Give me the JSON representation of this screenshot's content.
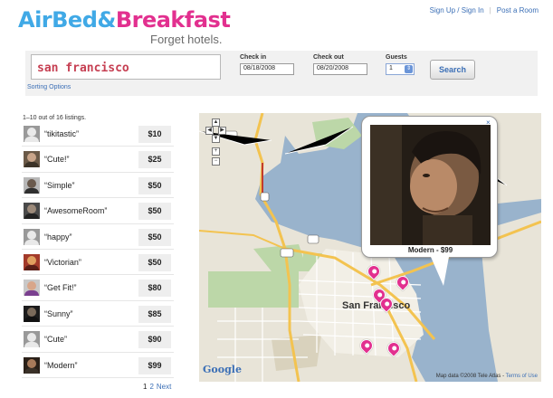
{
  "brand": {
    "part1": "AirBed",
    "amp": "&",
    "part2": "Breakfast",
    "tagline": "Forget hotels."
  },
  "header": {
    "signup": "Sign Up / Sign In",
    "sep": "|",
    "post": "Post a Room"
  },
  "search": {
    "where_value": "san francisco",
    "sorting": "Sorting Options",
    "checkin_label": "Check in",
    "checkin_value": "08/18/2008",
    "checkout_label": "Check out",
    "checkout_value": "08/20/2008",
    "guests_label": "Guests",
    "guests_value": "1",
    "button": "Search"
  },
  "results": {
    "count": "1–10 out of 16 listings.",
    "items": [
      {
        "name": "“tikitastic”",
        "price": "$10"
      },
      {
        "name": "“Cute!”",
        "price": "$25"
      },
      {
        "name": "“Simple”",
        "price": "$50"
      },
      {
        "name": "“AwesomeRoom”",
        "price": "$50"
      },
      {
        "name": "“happy”",
        "price": "$50"
      },
      {
        "name": "“Victorian”",
        "price": "$50"
      },
      {
        "name": "“Get Fit!”",
        "price": "$80"
      },
      {
        "name": "“Sunny”",
        "price": "$85"
      },
      {
        "name": "“Cute”",
        "price": "$90"
      },
      {
        "name": "“Modern”",
        "price": "$99"
      }
    ]
  },
  "pagination": {
    "p1": "1",
    "p2": "2",
    "next": "Next"
  },
  "map": {
    "city": "San Francisco",
    "popup_label": "Modern - $99",
    "google": "Google",
    "credit": "Map data ©2008 Tele Atlas -",
    "terms": "Terms of Use",
    "close": "×",
    "zoom_in": "+",
    "zoom_out": "−"
  },
  "colors": {
    "blue": "#40a9e6",
    "pink": "#e2308f",
    "link": "#3b6fb6",
    "query": "#c63f52"
  }
}
